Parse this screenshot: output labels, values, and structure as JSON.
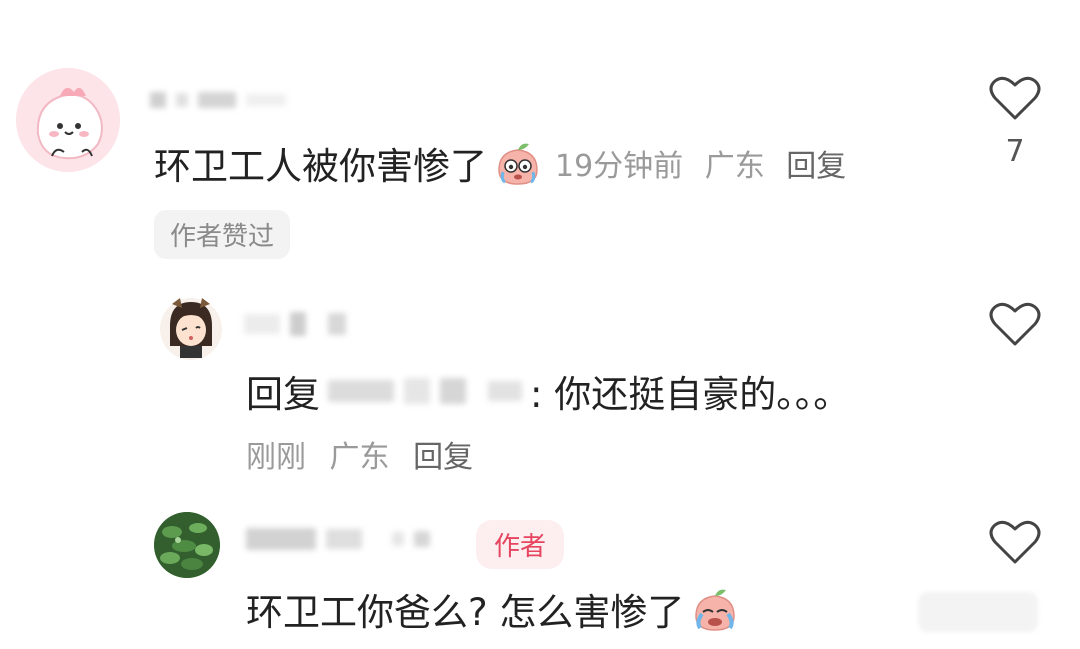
{
  "comments": [
    {
      "text": "环卫工人被你害惨了",
      "emoji": "crying-peach-emoji",
      "time": "19分钟前",
      "location": "广东",
      "reply_label": "回复",
      "like_count": "7",
      "liked_badge": "作者赞过"
    },
    {
      "reply_prefix": "回复",
      "text": ": 你还挺自豪的。。。",
      "time": "刚刚",
      "location": "广东",
      "reply_label": "回复"
    },
    {
      "author_tag": "作者",
      "text": "环卫工你爸么? 怎么害惨了",
      "emoji": "crying-peach-emoji"
    }
  ],
  "colors": {
    "text": "#222222",
    "meta": "#9a9a9a",
    "author_tag_bg": "#fdeef0",
    "author_tag_text": "#e5455f",
    "avatar_pink": "#fde1e6",
    "avatar_green": "#3f7a3a"
  }
}
